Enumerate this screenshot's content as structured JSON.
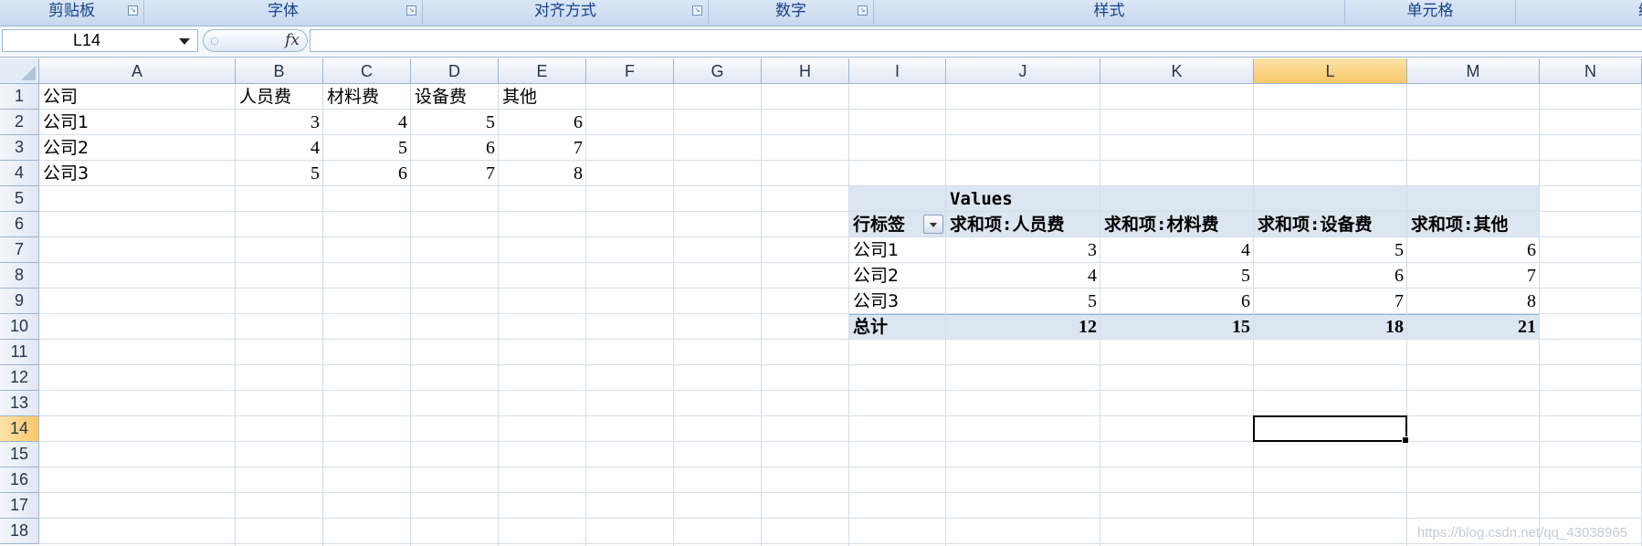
{
  "ribbon": {
    "groups": [
      "剪贴板",
      "字体",
      "对齐方式",
      "数字",
      "样式",
      "单元格",
      "编辑"
    ]
  },
  "formula_bar": {
    "name_box": "L14",
    "fx_label": "fx",
    "formula": ""
  },
  "columns": [
    "A",
    "B",
    "C",
    "D",
    "E",
    "F",
    "G",
    "H",
    "I",
    "J",
    "K",
    "L",
    "M",
    "N"
  ],
  "rows": [
    "1",
    "2",
    "3",
    "4",
    "5",
    "6",
    "7",
    "8",
    "9",
    "10",
    "11",
    "12",
    "13",
    "14",
    "15",
    "16",
    "17",
    "18"
  ],
  "selected_column": "L",
  "selected_row": "14",
  "table": {
    "header": [
      "公司",
      "人员费",
      "材料费",
      "设备费",
      "其他"
    ],
    "rows": [
      [
        "公司1",
        "3",
        "4",
        "5",
        "6"
      ],
      [
        "公司2",
        "4",
        "5",
        "6",
        "7"
      ],
      [
        "公司3",
        "5",
        "6",
        "7",
        "8"
      ]
    ]
  },
  "pivot": {
    "values_label": "Values",
    "row_label": "行标签",
    "headers": [
      "求和项:人员费",
      "求和项:材料费",
      "求和项:设备费",
      "求和项:其他"
    ],
    "rows": [
      [
        "公司1",
        "3",
        "4",
        "5",
        "6"
      ],
      [
        "公司2",
        "4",
        "5",
        "6",
        "7"
      ],
      [
        "公司3",
        "5",
        "6",
        "7",
        "8"
      ]
    ],
    "total": [
      "总计",
      "12",
      "15",
      "18",
      "21"
    ]
  },
  "colors": {
    "selected_header": "#f9c76a",
    "pivot_band": "#dce6f1",
    "ribbon_text": "#15428b"
  },
  "watermark": "https://blog.csdn.net/qq_43038965"
}
